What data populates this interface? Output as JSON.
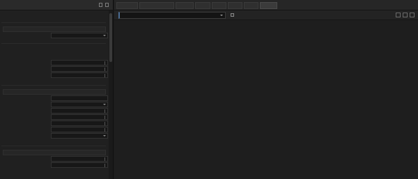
{
  "left_panel": {
    "title": "",
    "sections": [
      "",
      "",
      ""
    ],
    "rows": [
      {
        "label": "",
        "value": ""
      },
      {
        "label": "",
        "value": ""
      },
      {
        "label": "",
        "value": ""
      },
      {
        "label": "",
        "value": ""
      },
      {
        "label": "",
        "value": ""
      },
      {
        "label": "",
        "value": ""
      },
      {
        "label": "",
        "value": ""
      },
      {
        "label": "",
        "value": ""
      },
      {
        "label": "",
        "value": ""
      },
      {
        "label": "",
        "value": ""
      },
      {
        "label": "",
        "value": ""
      },
      {
        "label": "",
        "value": ""
      },
      {
        "label": "",
        "value": ""
      },
      {
        "label": "",
        "value": ""
      },
      {
        "label": "",
        "value": ""
      },
      {
        "label": "",
        "value": ""
      },
      {
        "label": "",
        "value": ""
      },
      {
        "label": "",
        "value": ""
      },
      {
        "label": "",
        "value": ""
      }
    ]
  },
  "tabs": [
    "",
    "",
    "",
    "",
    "",
    "",
    "",
    ""
  ],
  "toolbar": {
    "filter_value": "",
    "autoscroll_label": ""
  },
  "log_lines": [
    "",
    "",
    "",
    "",
    "",
    "",
    "",
    "",
    "",
    "",
    "",
    "",
    "",
    "",
    "",
    "",
    "",
    "",
    "",
    "",
    "",
    "",
    "",
    "",
    "",
    "",
    "",
    ""
  ]
}
